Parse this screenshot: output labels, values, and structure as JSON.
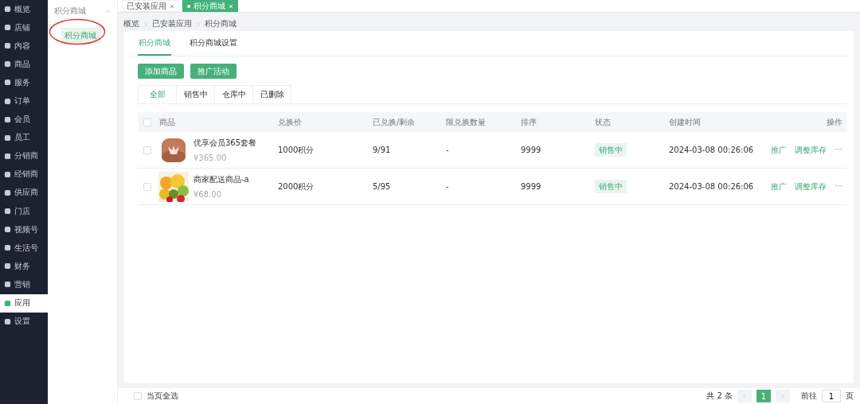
{
  "sidebar": {
    "items": [
      {
        "label": "概览",
        "selected": false
      },
      {
        "label": "店铺",
        "selected": false
      },
      {
        "label": "内容",
        "selected": false
      },
      {
        "label": "商品",
        "selected": false
      },
      {
        "label": "服务",
        "selected": false
      },
      {
        "label": "订单",
        "selected": false
      },
      {
        "label": "会员",
        "selected": false
      },
      {
        "label": "员工",
        "selected": false
      },
      {
        "label": "分销商",
        "selected": false
      },
      {
        "label": "经销商",
        "selected": false
      },
      {
        "label": "供应商",
        "selected": false
      },
      {
        "label": "门店",
        "selected": false
      },
      {
        "label": "视频号",
        "selected": false
      },
      {
        "label": "生活号",
        "selected": false
      },
      {
        "label": "财务",
        "selected": false
      },
      {
        "label": "营销",
        "selected": false
      },
      {
        "label": "应用",
        "selected": true
      },
      {
        "label": "设置",
        "selected": false
      }
    ]
  },
  "submenu": {
    "group": "积分商城",
    "expanded": true,
    "items": [
      {
        "label": "积分商城",
        "selected": true
      }
    ]
  },
  "page_tabs": [
    {
      "label": "已安装应用",
      "selected": false
    },
    {
      "label": "积分商城",
      "selected": true
    }
  ],
  "breadcrumb": [
    "概览",
    "已安装应用",
    "积分商城"
  ],
  "tabs": [
    {
      "label": "积分商城",
      "selected": true
    },
    {
      "label": "积分商城设置",
      "selected": false
    }
  ],
  "buttons": [
    "添加商品",
    "推广活动"
  ],
  "filter_tabs": [
    {
      "label": "全部",
      "selected": true
    },
    {
      "label": "销售中",
      "selected": false
    },
    {
      "label": "仓库中",
      "selected": false
    },
    {
      "label": "已删除",
      "selected": false
    }
  ],
  "table": {
    "all_checked": false,
    "columns": [
      "商品",
      "兑换价",
      "已兑换/剩余",
      "限兑换数量",
      "排序",
      "状态",
      "创建时间",
      "操作"
    ],
    "rows": [
      {
        "checked": false,
        "name": "优享会员365套餐",
        "price": "¥365.00",
        "points": "1000积分",
        "redeemed": "9/91",
        "limit": "-",
        "sort": "9999",
        "status": "销售中",
        "created": "2024-03-08 00:26:06",
        "actions": [
          "推广",
          "调整库存",
          "···"
        ]
      },
      {
        "checked": false,
        "name": "商家配送商品-a",
        "price": "¥68.00",
        "points": "2000积分",
        "redeemed": "5/95",
        "limit": "-",
        "sort": "9999",
        "status": "销售中",
        "created": "2024-03-08 00:26:06",
        "actions": [
          "推广",
          "调整库存",
          "···"
        ]
      }
    ]
  },
  "footer": {
    "select_all": {
      "label": "当页全选",
      "checked": false
    },
    "total": "共 2 条",
    "pages": [
      {
        "label": "1",
        "selected": true
      }
    ],
    "goto_label": "前往",
    "goto_value": "1",
    "goto_unit": "页"
  }
}
